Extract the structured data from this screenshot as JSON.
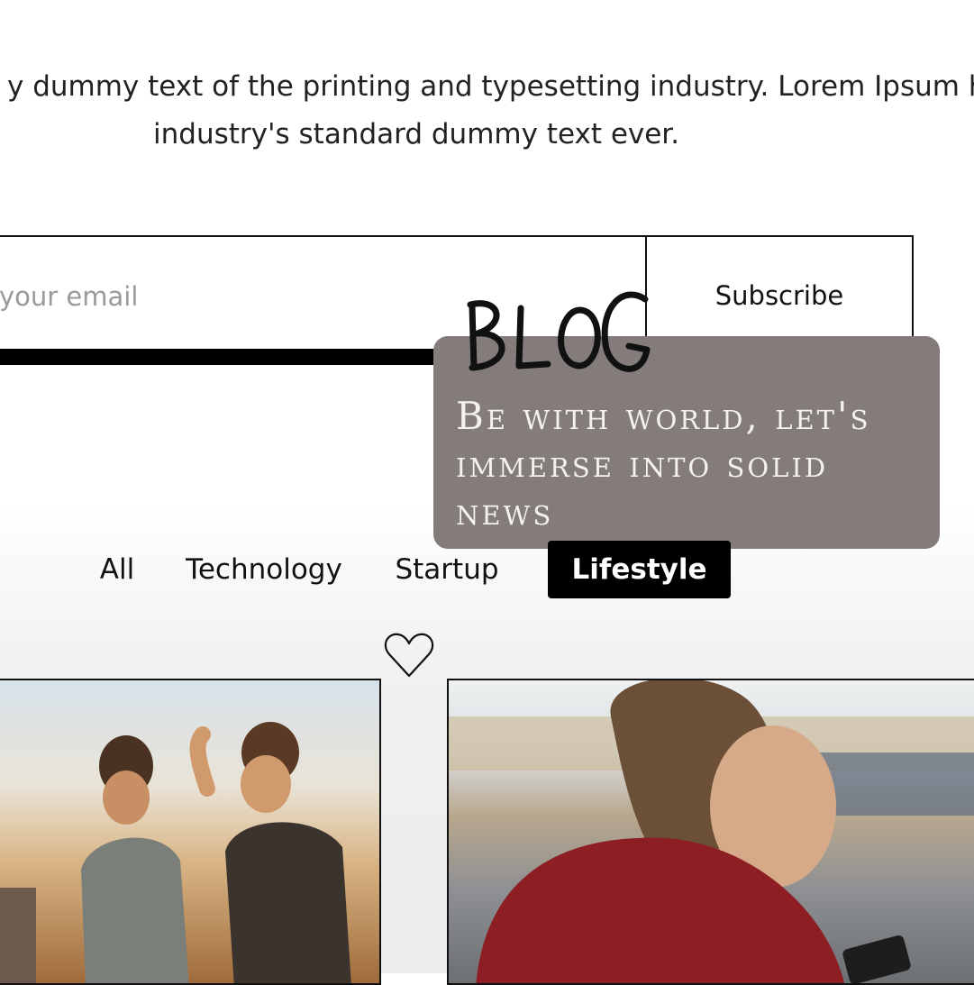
{
  "intro": {
    "line1": "y dummy text of the printing and typesetting industry. Lorem Ipsum ha",
    "line2": "industry's standard dummy text ever."
  },
  "newsletter": {
    "email_placeholder": "er your email",
    "subscribe_label": "Subscribe"
  },
  "overlay": {
    "logo_text": "BLOG",
    "tagline": "Be with world, let's immerse into solid news"
  },
  "filters": {
    "tabs": [
      {
        "label": "All",
        "active": false
      },
      {
        "label": "Technology",
        "active": false
      },
      {
        "label": "Startup",
        "active": false
      },
      {
        "label": "Lifestyle",
        "active": true
      }
    ]
  },
  "icons": {
    "favorite": "heart-icon"
  },
  "colors": {
    "accent": "#000000",
    "overlay": "#837c7b",
    "overlay_text": "#f4f1ef"
  },
  "posts": [
    {
      "image": "friends-celebrating-outdoors-photo"
    },
    {
      "image": "woman-looking-at-phone-photo"
    }
  ]
}
